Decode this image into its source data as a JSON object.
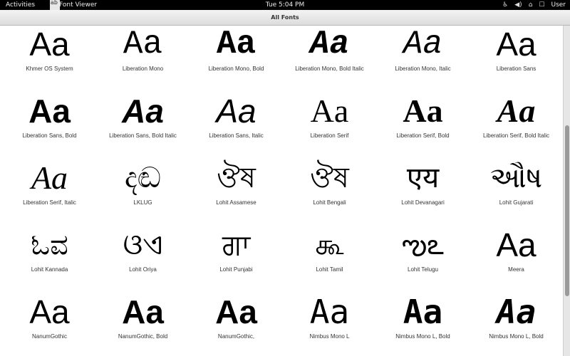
{
  "topbar": {
    "activities": "Activities",
    "app_icon_text": "ab",
    "app_name": "Font Viewer",
    "clock": "Tue  5:04 PM",
    "user": "User"
  },
  "window": {
    "title": "All Fonts"
  },
  "fonts": [
    {
      "label": "Khmer OS System",
      "sample": "Aa"
    },
    {
      "label": "Liberation Mono",
      "sample": "Aa"
    },
    {
      "label": "Liberation Mono, Bold",
      "sample": "Aa"
    },
    {
      "label": "Liberation Mono, Bold Italic",
      "sample": "Aa"
    },
    {
      "label": "Liberation Mono, Italic",
      "sample": "Aa"
    },
    {
      "label": "Liberation Sans",
      "sample": "Aa"
    },
    {
      "label": "Liberation Sans, Bold",
      "sample": "Aa"
    },
    {
      "label": "Liberation Sans, Bold Italic",
      "sample": "Aa"
    },
    {
      "label": "Liberation Sans, Italic",
      "sample": "Aa"
    },
    {
      "label": "Liberation Serif",
      "sample": "Aa"
    },
    {
      "label": "Liberation Serif, Bold",
      "sample": "Aa"
    },
    {
      "label": "Liberation Serif, Bold Italic",
      "sample": "Aa"
    },
    {
      "label": "Liberation Serif, Italic",
      "sample": "Aa"
    },
    {
      "label": "LKLUG",
      "sample": "දඬ"
    },
    {
      "label": "Lohit Assamese",
      "sample": "ঔষ"
    },
    {
      "label": "Lohit Bengali",
      "sample": "ঔষ"
    },
    {
      "label": "Lohit Devanagari",
      "sample": "एय"
    },
    {
      "label": "Lohit Gujarati",
      "sample": "ઔષ"
    },
    {
      "label": "Lohit Kannada",
      "sample": "ಓವ"
    },
    {
      "label": "Lohit Oriya",
      "sample": "ଓଏ"
    },
    {
      "label": "Lohit Punjabi",
      "sample": "ਗਾ"
    },
    {
      "label": "Lohit Tamil",
      "sample": "கூ"
    },
    {
      "label": "Lohit Telugu",
      "sample": "ఌఽ"
    },
    {
      "label": "Meera",
      "sample": "Aa"
    },
    {
      "label": "NanumGothic",
      "sample": "Aa"
    },
    {
      "label": "NanumGothic, Bold",
      "sample": "Aa"
    },
    {
      "label": "NanumGothic,",
      "sample": "Aa"
    },
    {
      "label": "Nimbus Mono L",
      "sample": "Aa"
    },
    {
      "label": "Nimbus Mono L, Bold",
      "sample": "Aa"
    },
    {
      "label": "Nimbus Mono L, Bold",
      "sample": "Aa"
    }
  ]
}
